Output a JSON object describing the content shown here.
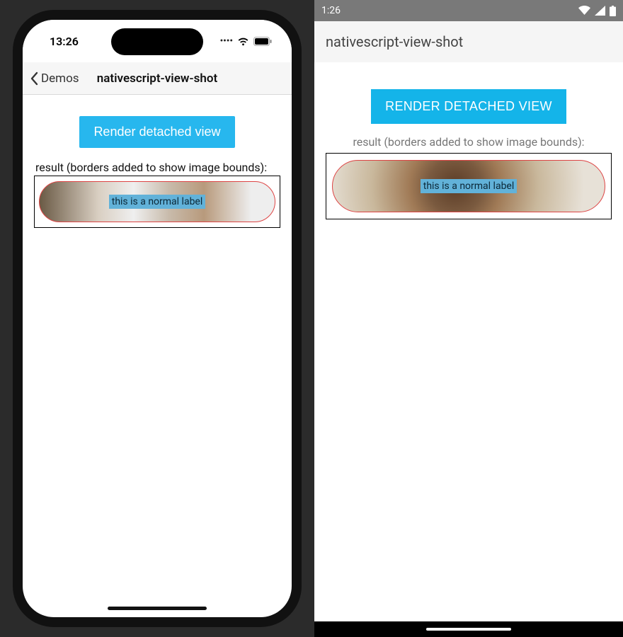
{
  "ios": {
    "status_time": "13:26",
    "back_label": "Demos",
    "title": "nativescript-view-shot",
    "render_button": "Render detached view",
    "result_caption": "result (borders added to show image bounds):",
    "image_label": "this is a normal label"
  },
  "android": {
    "status_time": "1:26",
    "title": "nativescript-view-shot",
    "render_button": "RENDER DETACHED VIEW",
    "result_caption": "result (borders added to show image bounds):",
    "image_label": "this is a normal label"
  },
  "colors": {
    "button_bg": "#14b4e9",
    "pill_border": "#d44444"
  }
}
